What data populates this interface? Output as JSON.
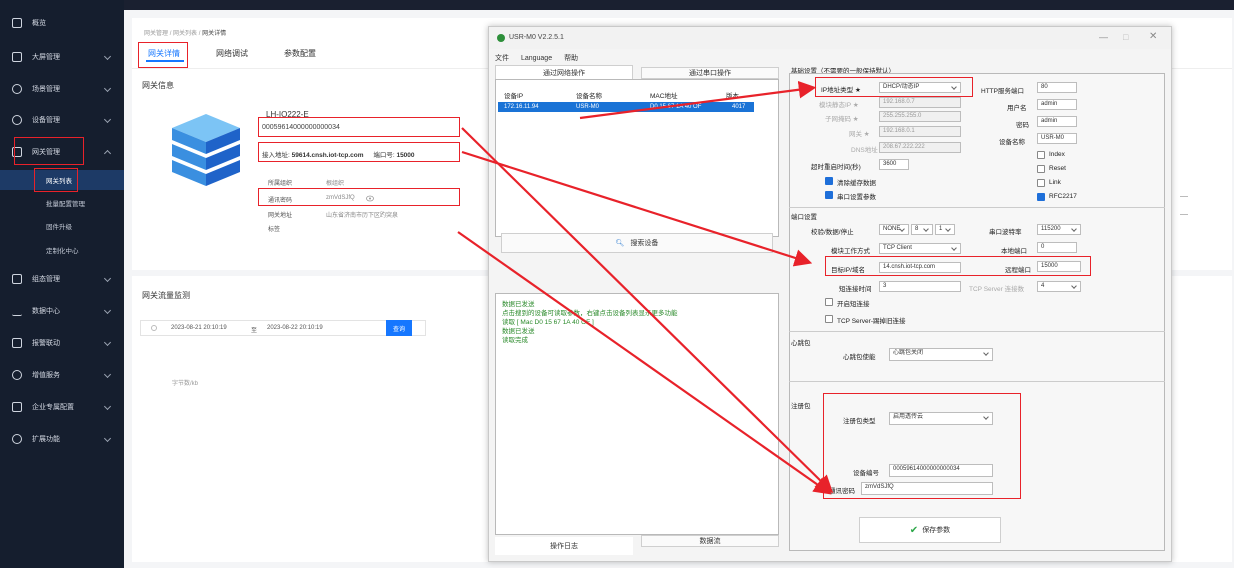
{
  "sidebar": {
    "items": [
      {
        "label": "概览"
      },
      {
        "label": "大屏管理"
      },
      {
        "label": "场景管理"
      },
      {
        "label": "设备管理"
      },
      {
        "label": "网关管理"
      },
      {
        "label": "组态管理"
      },
      {
        "label": "数据中心"
      },
      {
        "label": "报警联动"
      },
      {
        "label": "增值服务"
      },
      {
        "label": "企业专属配置"
      },
      {
        "label": "扩展功能"
      }
    ],
    "sub_items": [
      {
        "label": "网关列表"
      },
      {
        "label": "批量配置管理"
      },
      {
        "label": "固件升级"
      },
      {
        "label": "定制化中心"
      }
    ]
  },
  "breadcrumb": [
    "网关管理",
    "网关列表",
    "网关详情"
  ],
  "tabs": [
    "网关详情",
    "网络调试",
    "参数配置"
  ],
  "gateway_info": {
    "title": "网关信息",
    "model": "LH-IO222-E",
    "sn": "00059614000000000034",
    "access_label": "接入地址:",
    "access_value": "59614.cnsh.iot-tcp.com",
    "port_label": "端口号:",
    "port_value": "15000",
    "rows": [
      {
        "k": "所属组织",
        "v": "根组织"
      },
      {
        "k": "通讯密码",
        "v": "zmVdSJfQ"
      },
      {
        "k": "网关地址",
        "v": "山东省济南市历下区趵突泉"
      },
      {
        "k": "标签",
        "v": ""
      }
    ]
  },
  "traffic": {
    "title": "网关流量监测",
    "start": "2023-08-21 20:10:19",
    "to": "至",
    "end": "2023-08-22 20:10:19",
    "query": "查询",
    "unit": "字节数/kb"
  },
  "app": {
    "title": "USR-M0 V2.2.5.1",
    "menu": [
      "文件",
      "Language",
      "帮助"
    ],
    "left_tabs": [
      "通过网络操作",
      "通过串口操作"
    ],
    "device_table": {
      "headers": [
        "设备IP",
        "设备名称",
        "MAC地址",
        "版本"
      ],
      "row": [
        "172.16.11.94",
        "USR-M0",
        "D0 15 67 1A 40 OF",
        "4017"
      ]
    },
    "search_btn": "搜索设备",
    "log_lines": [
      "数据已发送",
      "点击搜到的设备可读取参数，右键点击设备列表显示更多功能",
      "读取 [ Mac   D0 15 67 1A 40 OF ]",
      "数据已发送",
      "读取完成"
    ],
    "bottom_tabs": [
      "操作日志",
      "数据流"
    ],
    "basic": {
      "title": "基础设置（不需要的一般保持默认）",
      "ip_type_label": "IP地址类型 ★",
      "ip_type_value": "DHCP/动态IP",
      "static_ip_label": "模块静态IP ★",
      "static_ip": "192.168.0.7",
      "mask_label": "子网掩码 ★",
      "mask": "255.255.255.0",
      "gw_label": "网关 ★",
      "gw": "192.168.0.1",
      "dns_label": "DNS地址",
      "dns": "208.67.222.222",
      "restart_label": "超时重启时间(秒)",
      "restart": "3600",
      "clear_cache": "清除缓存数据",
      "serial_params": "串口设置参数",
      "http_port_label": "HTTP服务端口",
      "http_port": "80",
      "user_label": "用户名",
      "user": "admin",
      "pwd_label": "密码",
      "pwd": "admin",
      "name_label": "设备名称",
      "name": "USR-M0",
      "checks": [
        "Index",
        "Reset",
        "Link",
        "RFC2217"
      ]
    },
    "port": {
      "title": "端口设置",
      "parity_label": "校验/数据/停止",
      "parity": "NONE",
      "data_bits": "8",
      "stop_bits": "1",
      "baud_label": "串口波特率",
      "baud": "115200",
      "mode_label": "模块工作方式",
      "mode": "TCP Client",
      "local_port_label": "本地端口",
      "local_port": "0",
      "target_label": "目标IP/域名",
      "target": "14.cnsh.iot-tcp.com",
      "remote_port_label": "远程端口",
      "remote_port": "15000",
      "short_label": "短连接时间",
      "short": "3",
      "tcp_server_label": "TCP Server 连接数",
      "tcp_server": "4",
      "open_short": "开启短连接",
      "kick": "TCP Server-踢掉旧连接"
    },
    "heartbeat": {
      "title": "心跳包",
      "enable_label": "心跳包使能",
      "enable_value": "心跳包关闭"
    },
    "register": {
      "title": "注册包",
      "type_label": "注册包类型",
      "type_value": "启用透传云",
      "sn_label": "设备编号",
      "sn": "00059614000000000034",
      "pwd_label": "通讯密码",
      "pwd": "zmVdSJfQ"
    },
    "save_btn": "保存参数"
  },
  "colors": {
    "highlight": "#e8222a",
    "accent": "#1677ff",
    "sidebar": "#151e2e"
  }
}
